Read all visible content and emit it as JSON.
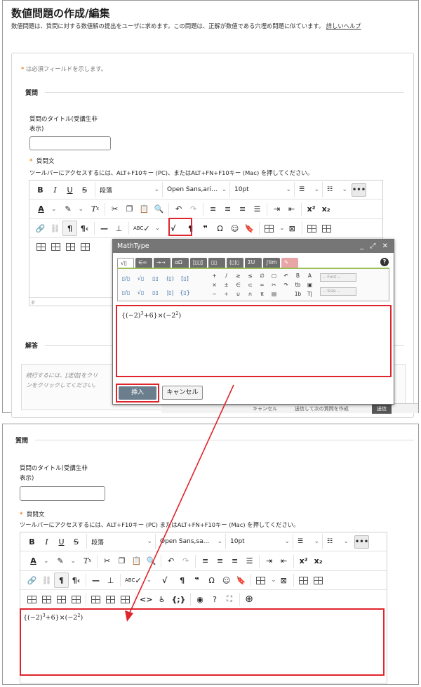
{
  "page": {
    "title": "数値問題の作成/編集",
    "description": "数値問題は、質問に対する数値解の提出をユーザに求めます。この問題は、正解が数値である穴埋め問題に似ています。",
    "help_link": "詳しいヘルプ",
    "required_note": "は必須フィールドを示します。"
  },
  "question_section": {
    "heading": "質問",
    "title_label_line1": "質問のタイトル(受講生非",
    "title_label_line2": "表示)",
    "title_value": "",
    "body_label": "質問文",
    "toolbar_hint": "ツールバーにアクセスするには、ALT+F10キー (PC)、またはALT+FN+F10キー (Mac) を押してください。",
    "bottom_toolbar_hint": "ツールバーにアクセスするには、ALT+F10キー (PC)   またはALT+FN+F10キー (Mac) を押してください。"
  },
  "toolbar": {
    "bold": "B",
    "italic": "I",
    "underline": "U",
    "strike": "S",
    "paragraph": "段落",
    "font": "Open Sans,ari...",
    "font_bottom": "Open Sans,sa...",
    "size": "10pt",
    "more": "•••",
    "superscript": "x²",
    "subscript": "x₂",
    "paragraph_mark": "¶",
    "quote": "❞",
    "omega": "Ω",
    "status_path": "p"
  },
  "mathtype": {
    "title": "MathType",
    "window_controls": "_ ⤢ ✕",
    "tabs": [
      "√▯",
      "∈∞",
      "→⇢",
      "αΩ",
      "[▯▯]",
      "▯▯",
      "(▯)▯",
      "ΣU",
      "∫lim",
      "✎"
    ],
    "help": "?",
    "palette_left": [
      "▯/▯",
      "√▯",
      "▯▯",
      "(▯)",
      "[▯]",
      "",
      "▯/▯",
      "√▯",
      "▯▯",
      "|▯|",
      "{▯}",
      ""
    ],
    "palette_right": [
      "+",
      "/",
      "≥",
      "≤",
      "∅",
      "▢",
      "↶",
      "B",
      "A",
      "×",
      "±",
      "∈",
      "⊂",
      "∞",
      "✂",
      "↷",
      "tb",
      "▣",
      "−",
      "÷",
      "∪",
      "∩",
      "π",
      "▤",
      "",
      "1b",
      "T|"
    ],
    "font_select": "-- Font --",
    "size_select": "-- Size --",
    "formula": {
      "open": "{(−2)",
      "exp1": "3",
      "mid": "+6}×(−2",
      "exp2": "2",
      "close": ")"
    },
    "insert_button": "挿入",
    "cancel_button": "キャンセル"
  },
  "answer_section": {
    "heading": "解答",
    "hint_line1": "続行するには、[送信]をクリ",
    "hint_line2": "ンをクリックしてください。",
    "footer_cancel": "キャンセル",
    "footer_save_next": "送信して次の質問を作成",
    "footer_submit": "送信"
  },
  "colors": {
    "highlight": "#e0242b",
    "insert_button": "#6b7e8e",
    "asterisk": "#e88a2a"
  }
}
